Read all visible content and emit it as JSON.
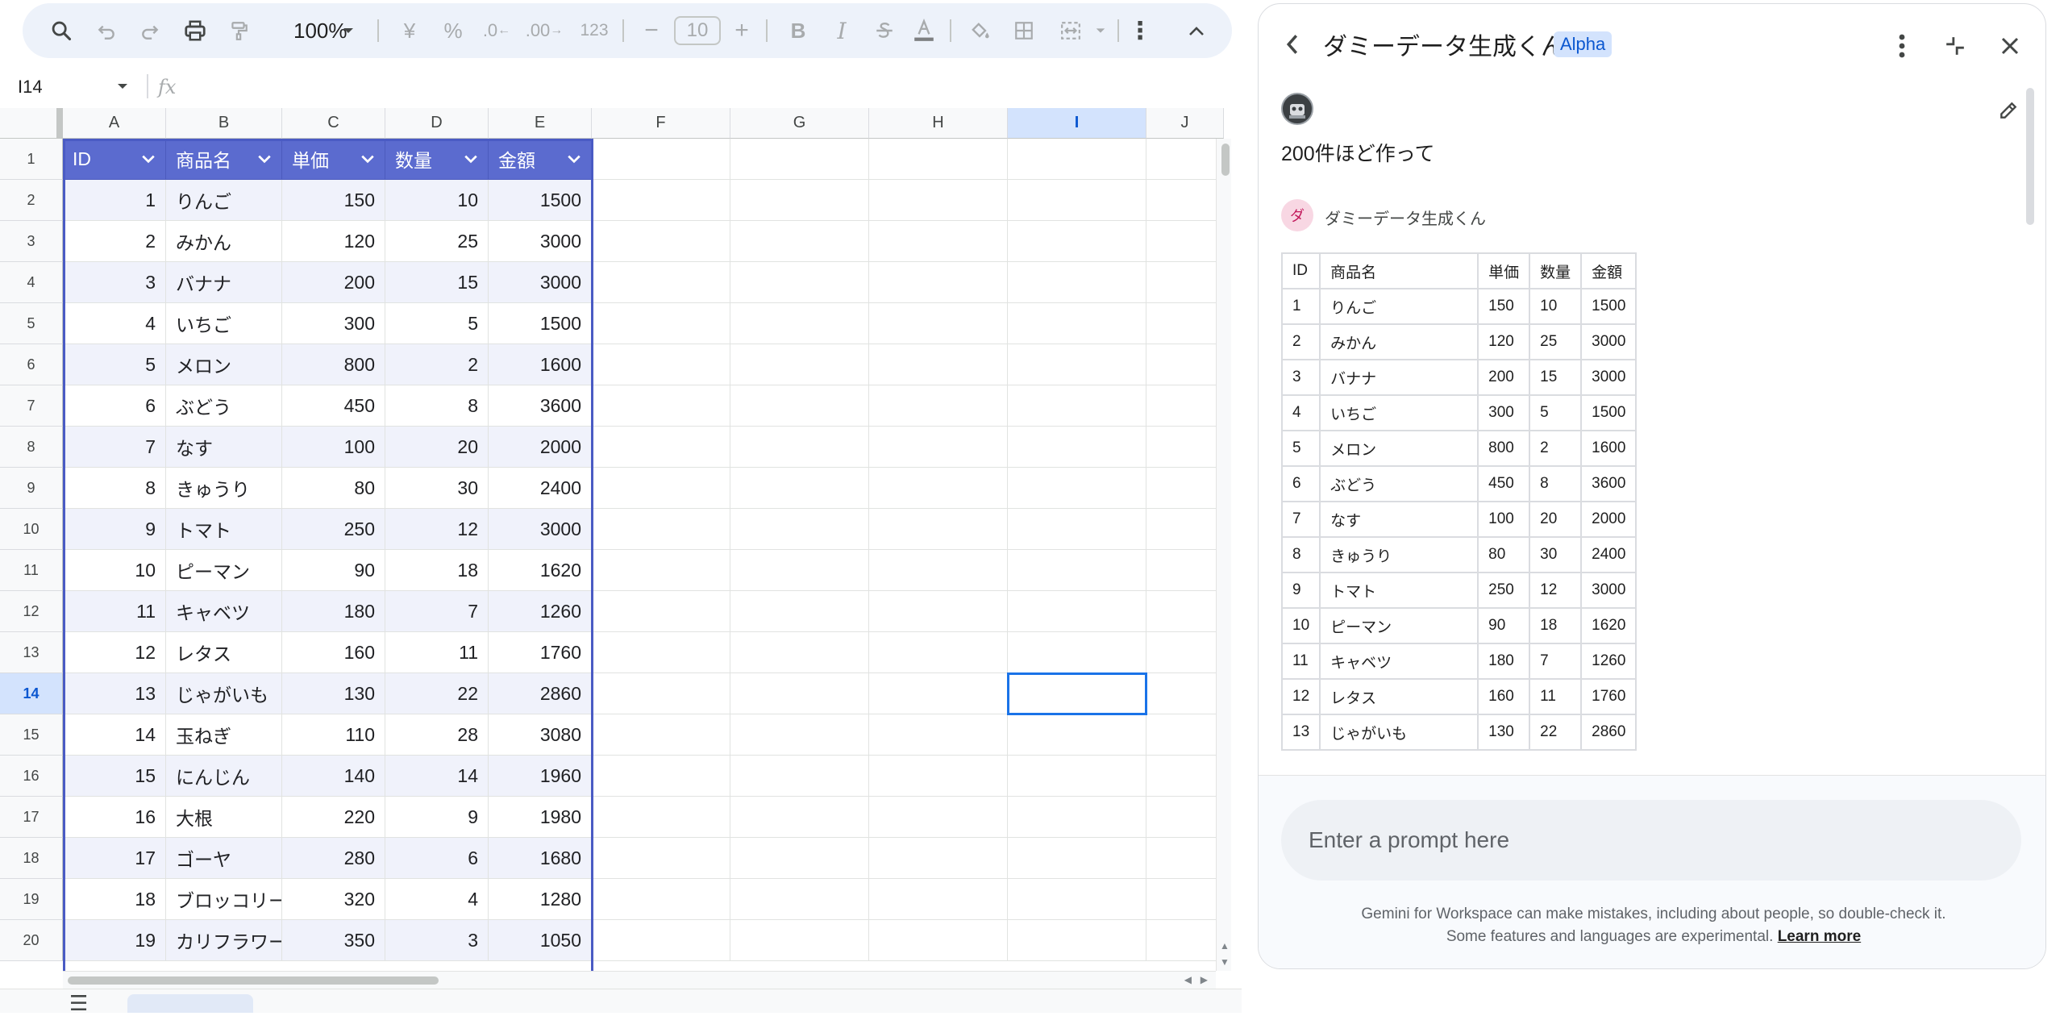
{
  "toolbar": {
    "zoom": "100%",
    "font_size": "10",
    "currency_symbol": "¥",
    "percent_symbol": "%",
    "decrease_decimal": ".0",
    "increase_decimal": ".00",
    "number_format": "123",
    "bold": "B",
    "italic": "I",
    "minus": "−",
    "plus": "+",
    "more": "⋮"
  },
  "formula_bar": {
    "cell_ref": "I14",
    "fx": "fx"
  },
  "sheet": {
    "columns": [
      "A",
      "B",
      "C",
      "D",
      "E",
      "F",
      "G",
      "H",
      "I",
      "J"
    ],
    "selected_column": "I",
    "row_numbers": [
      "1",
      "2",
      "3",
      "4",
      "5",
      "6",
      "7",
      "8",
      "9",
      "10",
      "11",
      "12",
      "13",
      "14",
      "15",
      "16",
      "17",
      "18",
      "19",
      "20"
    ],
    "selected_row": "14",
    "headers": [
      "ID",
      "商品名",
      "単価",
      "数量",
      "金額"
    ],
    "rows": [
      [
        "1",
        "りんご",
        "150",
        "10",
        "1500"
      ],
      [
        "2",
        "みかん",
        "120",
        "25",
        "3000"
      ],
      [
        "3",
        "バナナ",
        "200",
        "15",
        "3000"
      ],
      [
        "4",
        "いちご",
        "300",
        "5",
        "1500"
      ],
      [
        "5",
        "メロン",
        "800",
        "2",
        "1600"
      ],
      [
        "6",
        "ぶどう",
        "450",
        "8",
        "3600"
      ],
      [
        "7",
        "なす",
        "100",
        "20",
        "2000"
      ],
      [
        "8",
        "きゅうり",
        "80",
        "30",
        "2400"
      ],
      [
        "9",
        "トマト",
        "250",
        "12",
        "3000"
      ],
      [
        "10",
        "ピーマン",
        "90",
        "18",
        "1620"
      ],
      [
        "11",
        "キャベツ",
        "180",
        "7",
        "1260"
      ],
      [
        "12",
        "レタス",
        "160",
        "11",
        "1760"
      ],
      [
        "13",
        "じゃがいも",
        "130",
        "22",
        "2860"
      ],
      [
        "14",
        "玉ねぎ",
        "110",
        "28",
        "3080"
      ],
      [
        "15",
        "にんじん",
        "140",
        "14",
        "1960"
      ],
      [
        "16",
        "大根",
        "220",
        "9",
        "1980"
      ],
      [
        "17",
        "ゴーヤ",
        "280",
        "6",
        "1680"
      ],
      [
        "18",
        "ブロッコリー",
        "320",
        "4",
        "1280"
      ],
      [
        "19",
        "カリフラワー",
        "350",
        "3",
        "1050"
      ]
    ],
    "colors": {
      "header_bg": "#5b6bcf",
      "band_bg": "#f0f2fb",
      "selection": "#1a73e8"
    }
  },
  "panel": {
    "title": "ダミーデータ生成くん",
    "badge": "Alpha",
    "user_prompt": "200件ほど作って",
    "bot_initial": "ダ",
    "bot_name": "ダミーデータ生成くん",
    "table_headers": [
      "ID",
      "商品名",
      "単価",
      "数量",
      "金額"
    ],
    "table_rows": [
      [
        "1",
        "りんご",
        "150",
        "10",
        "1500"
      ],
      [
        "2",
        "みかん",
        "120",
        "25",
        "3000"
      ],
      [
        "3",
        "バナナ",
        "200",
        "15",
        "3000"
      ],
      [
        "4",
        "いちご",
        "300",
        "5",
        "1500"
      ],
      [
        "5",
        "メロン",
        "800",
        "2",
        "1600"
      ],
      [
        "6",
        "ぶどう",
        "450",
        "8",
        "3600"
      ],
      [
        "7",
        "なす",
        "100",
        "20",
        "2000"
      ],
      [
        "8",
        "きゅうり",
        "80",
        "30",
        "2400"
      ],
      [
        "9",
        "トマト",
        "250",
        "12",
        "3000"
      ],
      [
        "10",
        "ピーマン",
        "90",
        "18",
        "1620"
      ],
      [
        "11",
        "キャベツ",
        "180",
        "7",
        "1260"
      ],
      [
        "12",
        "レタス",
        "160",
        "11",
        "1760"
      ],
      [
        "13",
        "じゃがいも",
        "130",
        "22",
        "2860"
      ]
    ],
    "prompt_placeholder": "Enter a prompt here",
    "disclaimer": "Gemini for Workspace can make mistakes, including about people, so double-check it. Some features and languages are experimental.",
    "learn_more": "Learn more"
  }
}
